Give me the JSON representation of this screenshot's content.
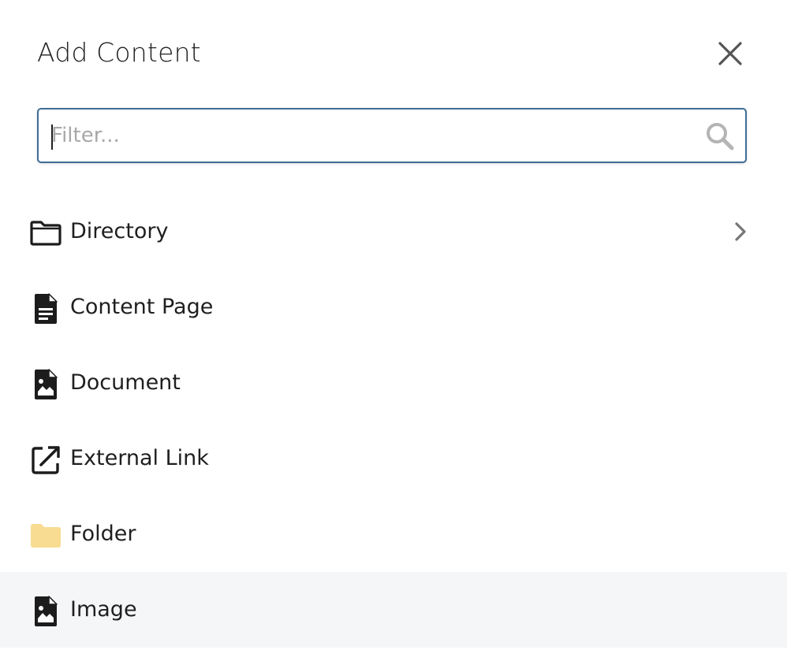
{
  "dialog": {
    "title": "Add Content",
    "close_icon": "close-icon"
  },
  "search": {
    "placeholder": "Filter...",
    "value": "",
    "icon": "search-icon"
  },
  "items": [
    {
      "label": "Directory",
      "icon": "folder-outline-icon",
      "has_submenu": true
    },
    {
      "label": "Content Page",
      "icon": "document-text-icon",
      "has_submenu": false
    },
    {
      "label": "Document",
      "icon": "document-image-icon",
      "has_submenu": false
    },
    {
      "label": "External Link",
      "icon": "external-link-icon",
      "has_submenu": false
    },
    {
      "label": "Folder",
      "icon": "folder-filled-icon",
      "has_submenu": false
    },
    {
      "label": "Image",
      "icon": "image-file-icon",
      "has_submenu": false,
      "selected": true
    }
  ],
  "colors": {
    "search_border": "#3f6e98",
    "folder_fill": "#f8dc91",
    "selected_row": "#f5f6f8",
    "icon_dark": "#1c1c1c"
  }
}
